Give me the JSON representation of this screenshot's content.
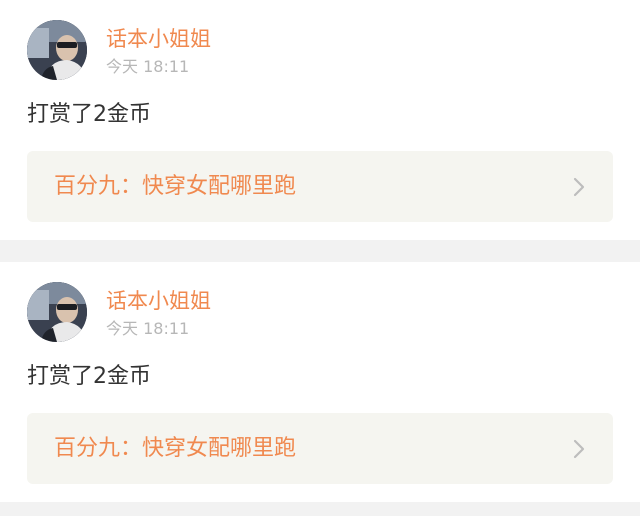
{
  "feed": {
    "items": [
      {
        "user_name": "话本小姐姐",
        "time": "今天 18:11",
        "message": "打赏了2金币",
        "book_title": "百分九：快穿女配哪里跑",
        "chevron_icon": "chevron-right-icon"
      },
      {
        "user_name": "话本小姐姐",
        "time": "今天 18:11",
        "message": "打赏了2金币",
        "book_title": "百分九：快穿女配哪里跑",
        "chevron_icon": "chevron-right-icon"
      }
    ]
  },
  "colors": {
    "accent": "#f0894f",
    "timestamp": "#b7b7b7",
    "text": "#333333",
    "link_background": "#f5f5f0",
    "separator": "#f2f2f2"
  }
}
